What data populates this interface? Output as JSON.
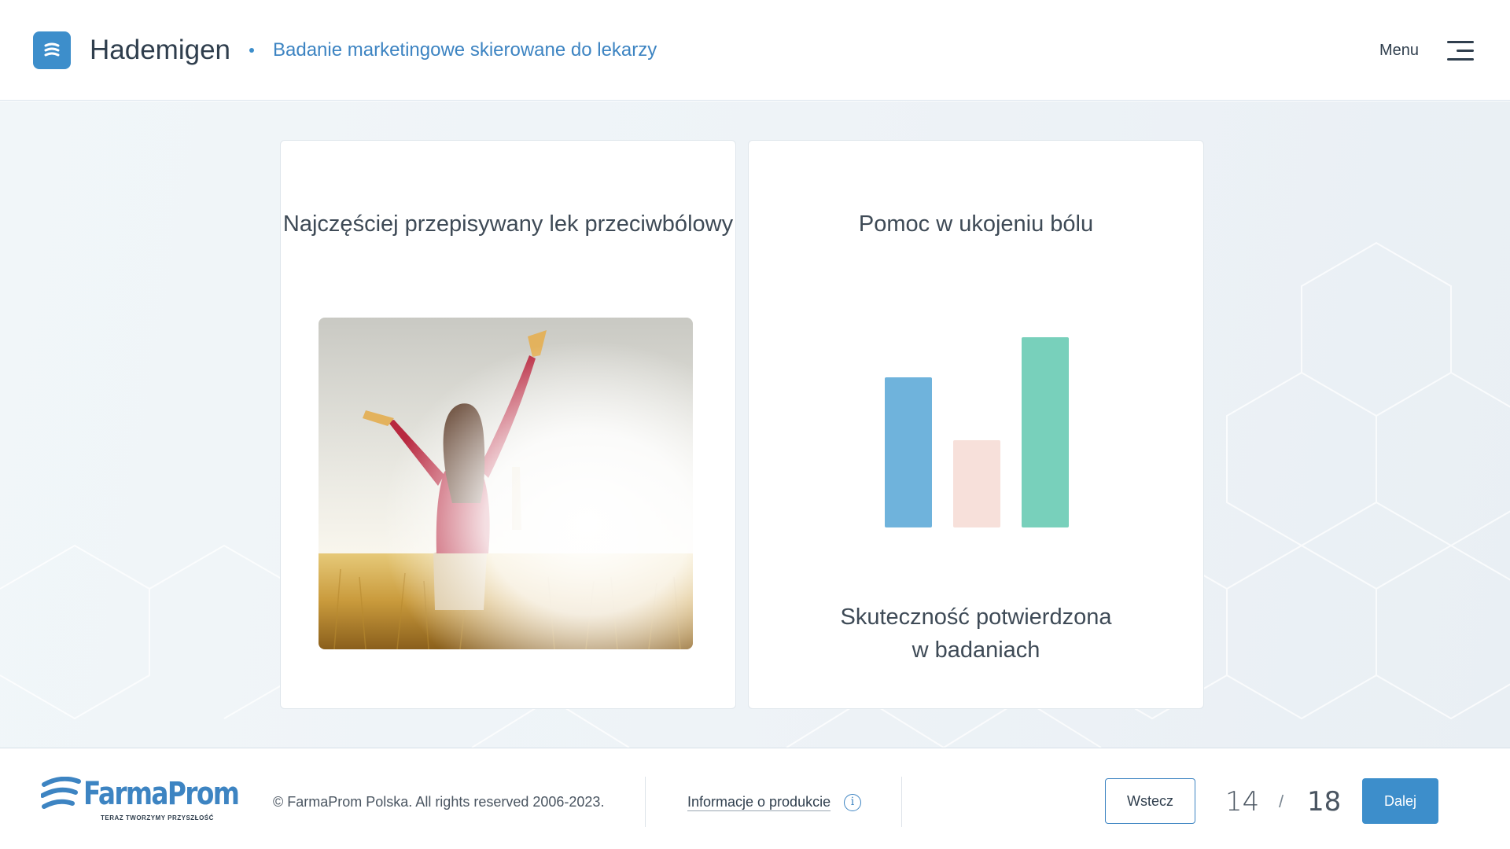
{
  "header": {
    "app_title": "Hademigen",
    "subtitle": "Badanie marketingowe skierowane do lekarzy",
    "menu_label": "Menu"
  },
  "cards": {
    "left": {
      "title": "Najczęściej przepisywany lek przeciwbólowy",
      "image": "woman-in-field-photo"
    },
    "right": {
      "title": "Pomoc w ukojeniu bólu",
      "caption_line1": "Skuteczność potwierdzona",
      "caption_line2": "w badaniach",
      "bars": [
        {
          "level": 0.79,
          "color": "#6fb3dc"
        },
        {
          "level": 0.46,
          "color": "#f7e0da"
        },
        {
          "level": 1.0,
          "color": "#78d0bb"
        }
      ]
    }
  },
  "footer": {
    "brand_name": "FarmaProm",
    "brand_tagline": "TERAZ TWORZYMY PRZYSZŁOŚĆ",
    "copyright": "© FarmaProm Polska. All rights reserved 2006-2023.",
    "info_link": "Informacje o produkcie",
    "back_label": "Wstecz",
    "page_current": "14",
    "page_separator": "/",
    "page_total": "18",
    "next_label": "Dalej"
  },
  "colors": {
    "accent": "#3d8ecb",
    "link": "#3d84c2",
    "text": "#2f3e4d"
  }
}
